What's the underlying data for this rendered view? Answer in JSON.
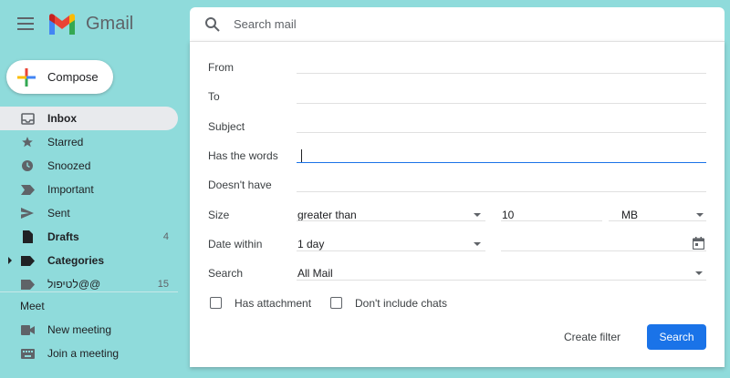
{
  "header": {
    "app_name": "Gmail",
    "menu_icon": "hamburger-menu-icon",
    "logo_icon": "gmail-logo-icon"
  },
  "compose": {
    "label": "Compose",
    "icon": "plus-icon"
  },
  "nav": {
    "items": [
      {
        "label": "Inbox",
        "icon": "inbox-icon",
        "count": "",
        "active": true,
        "bold": true
      },
      {
        "label": "Starred",
        "icon": "star-icon",
        "count": ""
      },
      {
        "label": "Snoozed",
        "icon": "clock-icon",
        "count": ""
      },
      {
        "label": "Important",
        "icon": "label-important-icon",
        "count": ""
      },
      {
        "label": "Sent",
        "icon": "send-icon",
        "count": ""
      },
      {
        "label": "Drafts",
        "icon": "draft-icon",
        "count": "4",
        "bold": true
      },
      {
        "label": "Categories",
        "icon": "label-icon",
        "count": "",
        "bold": true
      },
      {
        "label": "לטיפול@@",
        "icon": "label-icon",
        "count": "15"
      }
    ],
    "meet_title": "Meet",
    "meet_items": [
      {
        "label": "New meeting",
        "icon": "videocam-icon"
      },
      {
        "label": "Join a meeting",
        "icon": "keyboard-icon"
      }
    ]
  },
  "search": {
    "placeholder": "Search mail",
    "icon": "search-icon"
  },
  "advanced": {
    "from_label": "From",
    "to_label": "To",
    "subject_label": "Subject",
    "has_words_label": "Has the words",
    "doesnt_have_label": "Doesn't have",
    "size_label": "Size",
    "size_operator": "greater than",
    "size_value": "10",
    "size_unit": "MB",
    "date_within_label": "Date within",
    "date_within_value": "1 day",
    "calendar_icon": "calendar-icon",
    "search_label": "Search",
    "search_scope": "All Mail",
    "has_attachment_label": "Has attachment",
    "dont_include_chats_label": "Don't include chats",
    "create_filter_label": "Create filter",
    "search_button_label": "Search"
  },
  "colors": {
    "background": "#8fdbdb",
    "accent": "#1a73e8"
  }
}
